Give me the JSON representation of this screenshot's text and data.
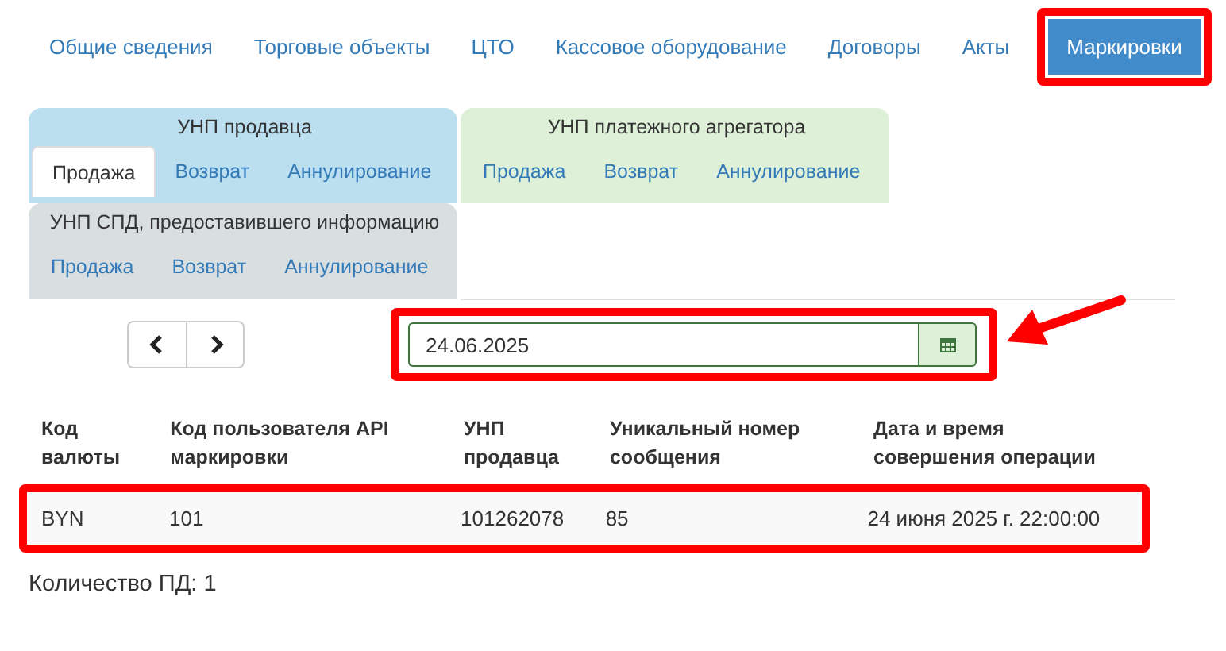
{
  "nav_tabs": [
    {
      "label": "Общие сведения",
      "selected": false
    },
    {
      "label": "Торговые объекты",
      "selected": false
    },
    {
      "label": "ЦТО",
      "selected": false
    },
    {
      "label": "Кассовое оборудование",
      "selected": false
    },
    {
      "label": "Договоры",
      "selected": false
    },
    {
      "label": "Акты",
      "selected": false
    },
    {
      "label": "Маркировки",
      "selected": true
    }
  ],
  "tab_groups": [
    {
      "title": "УНП продавца",
      "color": "#bcdff0",
      "tabs": [
        {
          "label": "Продажа",
          "selected": true
        },
        {
          "label": "Возврат",
          "selected": false
        },
        {
          "label": "Аннулирование",
          "selected": false
        }
      ]
    },
    {
      "title": "УНП платежного агрегатора",
      "color": "#dff0d8",
      "tabs": [
        {
          "label": "Продажа",
          "selected": false
        },
        {
          "label": "Возврат",
          "selected": false
        },
        {
          "label": "Аннулирование",
          "selected": false
        }
      ]
    },
    {
      "title": "УНП СПД, предоставившего информацию",
      "color": "#d9dee0",
      "tabs": [
        {
          "label": "Продажа",
          "selected": false
        },
        {
          "label": "Возврат",
          "selected": false
        },
        {
          "label": "Аннулирование",
          "selected": false
        }
      ]
    }
  ],
  "date_field": {
    "value": "24.06.2025"
  },
  "table": {
    "columns": [
      "Код валюты",
      "Код пользователя API маркировки",
      "УНП продавца",
      "Уникальный номер сообщения",
      "Дата и время совершения операции"
    ],
    "rows": [
      [
        "BYN",
        "101",
        "101262078",
        "85",
        "24 июня 2025 г. 22:00:00"
      ]
    ]
  },
  "footer": "Количество ПД: 1"
}
